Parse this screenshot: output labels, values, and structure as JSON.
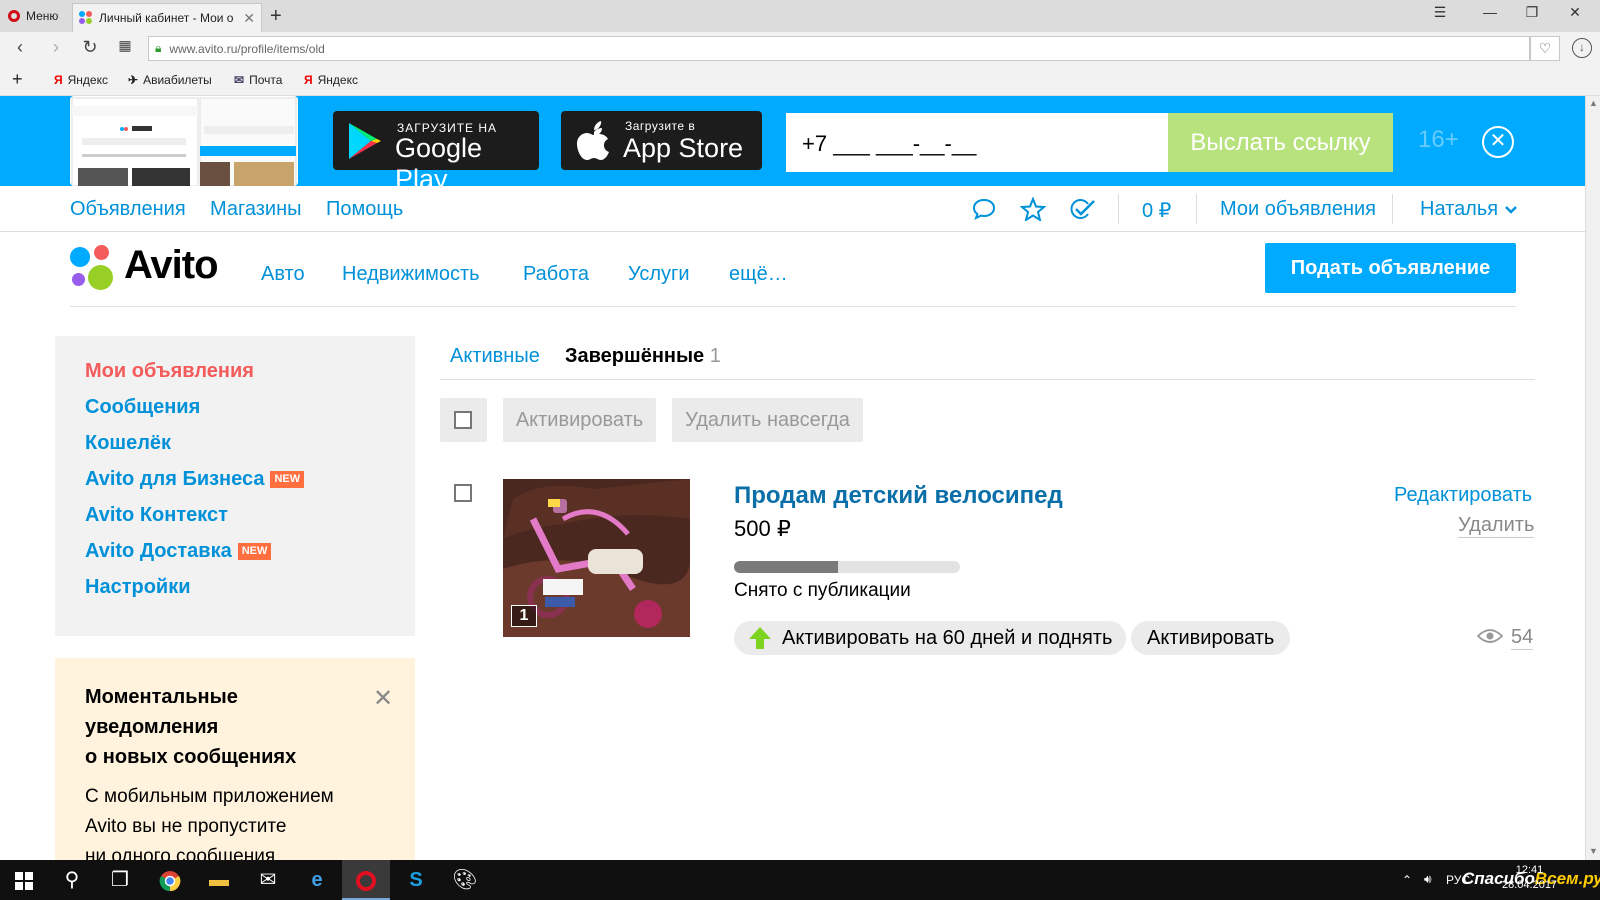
{
  "browser": {
    "menu_label": "Меню",
    "tab_title": "Личный кабинет - Мои о",
    "tab_close": "✕",
    "url": "www.avito.ru/profile/items/old",
    "bookmarks": [
      "Яндекс",
      "Авиабилеты",
      "Почта",
      "Яндекс"
    ]
  },
  "banner": {
    "google_small": "ЗАГРУЗИТЕ НА",
    "google_big": "Google Play",
    "apple_small": "Загрузите в",
    "apple_big": "App Store",
    "phone_placeholder": "+7 ___ ___-__-__",
    "send_label": "Выслать ссылку",
    "age": "16+"
  },
  "topnav": {
    "links": [
      "Объявления",
      "Магазины",
      "Помощь"
    ],
    "balance": "0 ₽",
    "my_ads": "Мои объявления",
    "user": "Наталья"
  },
  "header": {
    "logo": "Avito",
    "categories": [
      "Авто",
      "Недвижимость",
      "Работа",
      "Услуги",
      "ещё…"
    ],
    "post_ad": "Подать объявление"
  },
  "sidebar": {
    "items": [
      {
        "label": "Мои объявления",
        "active": true
      },
      {
        "label": "Сообщения"
      },
      {
        "label": "Кошелёк"
      },
      {
        "label": "Avito для Бизнеса",
        "badge": "NEW"
      },
      {
        "label": "Avito Контекст"
      },
      {
        "label": "Avito Доставка",
        "badge": "NEW"
      },
      {
        "label": "Настройки"
      }
    ]
  },
  "notify": {
    "title": "Моментальные\nуведомления\nо новых сообщениях",
    "text": "С мобильным приложением\nAvito вы не пропустите\nни одного сообщения"
  },
  "main": {
    "tab_active": "Активные",
    "tab_done": "Завершённые",
    "tab_done_count": "1",
    "bulk_activate": "Активировать",
    "bulk_delete": "Удалить навсегда"
  },
  "item": {
    "title": "Продам детский велосипед",
    "price": "500 ₽",
    "progress": 0.46,
    "status": "Снято с публикации",
    "photo_count": "1",
    "activate_up": "Активировать на 60 дней и поднять",
    "activate": "Активировать",
    "edit": "Редактировать",
    "delete": "Удалить",
    "views": "54"
  },
  "taskbar": {
    "lang": "РУС",
    "time": "12:41",
    "date": "28.04.2017",
    "watermark_a": "Спасибо",
    "watermark_b": "Всем.ру"
  },
  "colors": {
    "accent": "#00aaff",
    "link": "#0091d9",
    "active": "#f45b5b",
    "badge": "#ff6f3f",
    "send": "#b8e27d"
  }
}
